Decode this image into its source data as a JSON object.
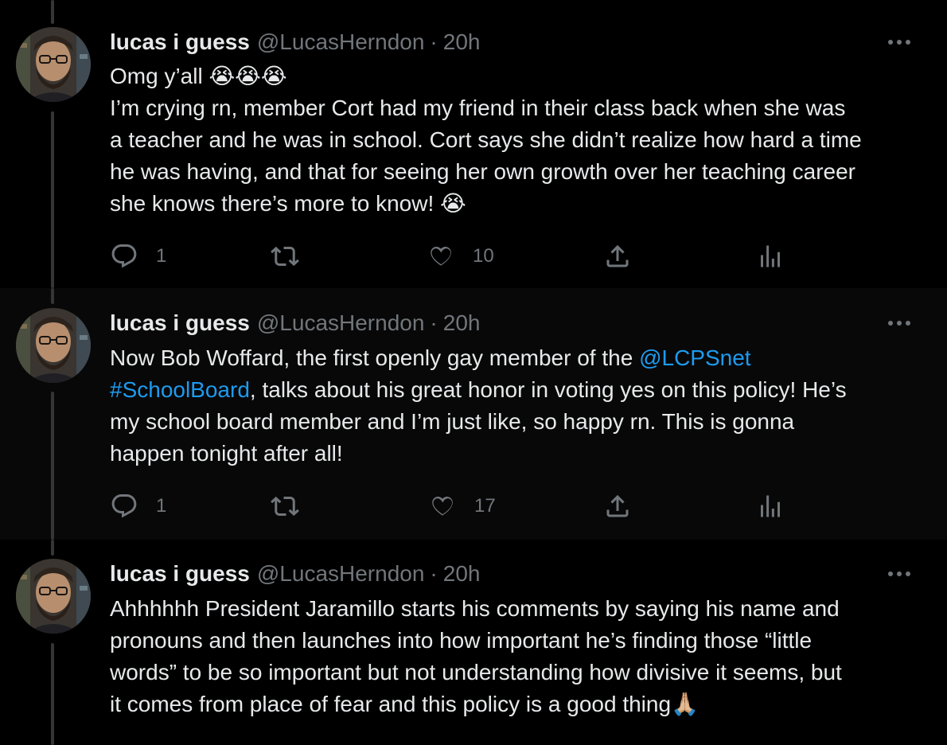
{
  "thread": {
    "tweets": [
      {
        "author_name": "lucas i guess",
        "author_handle": "@LucasHerndon",
        "separator": "·",
        "time": "20h",
        "lines": [
          "Omg y’all 😭😭😭",
          "I’m crying rn, member Cort had my friend in their class back when she was",
          "a teacher and he was in school. Cort says she didn’t realize how hard a time",
          "he was having, and that for seeing her own growth over her teaching career",
          "she knows there’s more to know! 😭"
        ],
        "replies": "1",
        "retweets": "",
        "likes": "10"
      },
      {
        "author_name": "lucas i guess",
        "author_handle": "@LucasHerndon",
        "separator": "·",
        "time": "20h",
        "line1_text": "Now Bob Woffard, the first openly gay member of the ",
        "line1_mention": "@LCPSnet",
        "line2_hashtag": "#SchoolBoard",
        "line2_text": ", talks about his great honor in voting yes on this policy! He’s",
        "line3": "my school board member and I’m just like, so happy rn. This is gonna",
        "line4": "happen tonight after all!",
        "replies": "1",
        "retweets": "",
        "likes": "17"
      },
      {
        "author_name": "lucas i guess",
        "author_handle": "@LucasHerndon",
        "separator": "·",
        "time": "20h",
        "lines": [
          "Ahhhhhh President Jaramillo starts his comments by saying his name and",
          "pronouns and then launches into how important he’s finding those “little",
          "words” to be so important but not understanding how divisive it seems, but",
          "it comes from place of fear and this policy is a good thing🙏🏼"
        ]
      }
    ]
  },
  "colors": {
    "background": "#000000",
    "alt_background": "#080808",
    "text": "#e7e9ea",
    "muted": "#71767b",
    "link": "#1d9bf0",
    "thread_line": "#333639"
  },
  "icons": [
    "more-icon",
    "reply-icon",
    "retweet-icon",
    "like-icon",
    "share-icon",
    "analytics-icon"
  ]
}
